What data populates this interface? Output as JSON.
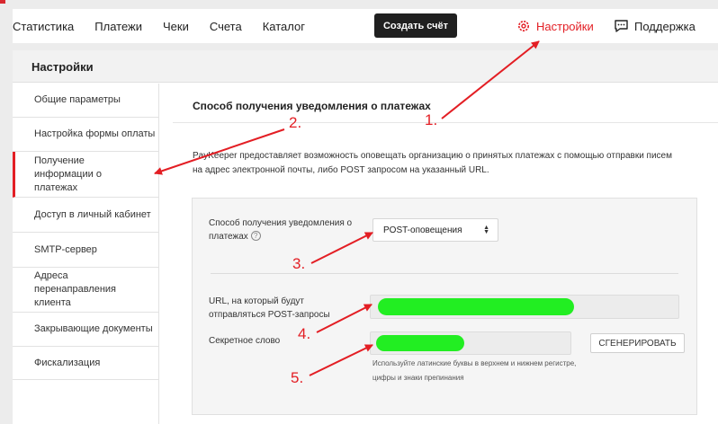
{
  "nav": {
    "items": [
      "Статистика",
      "Платежи",
      "Чеки",
      "Счета",
      "Каталог"
    ],
    "create_button": "Создать счёт",
    "settings_label": "Настройки",
    "support_label": "Поддержка"
  },
  "panel": {
    "title": "Настройки"
  },
  "sidebar": {
    "items": [
      {
        "label": "Общие параметры"
      },
      {
        "label": "Настройка формы оплаты"
      },
      {
        "label": "Получение информации о платежах"
      },
      {
        "label": "Доступ в личный кабинет"
      },
      {
        "label": "SMTP-сервер"
      },
      {
        "label": "Адреса перенаправления клиента"
      },
      {
        "label": "Закрывающие документы"
      },
      {
        "label": "Фискализация"
      }
    ]
  },
  "main": {
    "title": "Способ получения уведомления о платежах",
    "description": "PayKeeper предоставляет возможность оповещать организацию о принятых платежах с помощью отправки писем на адрес электронной почты, либо POST запросом на указанный URL.",
    "form": {
      "method_label": "Способ получения уведомления о платежах",
      "method_value": "POST-оповещения",
      "url_label": "URL, на который будут отправляться POST-запросы",
      "secret_label": "Секретное слово",
      "generate_button": "СГЕНЕРИРОВАТЬ",
      "hint": "Используйте латинские буквы в верхнем и нижнем регистре, цифры и знаки препинания"
    }
  },
  "annotations": {
    "numbers": [
      "1.",
      "2.",
      "3.",
      "4.",
      "5."
    ],
    "color": "#e31e24"
  },
  "colors": {
    "accent": "#e31e24",
    "highlight": "#22ee22",
    "dark_button": "#202020"
  }
}
